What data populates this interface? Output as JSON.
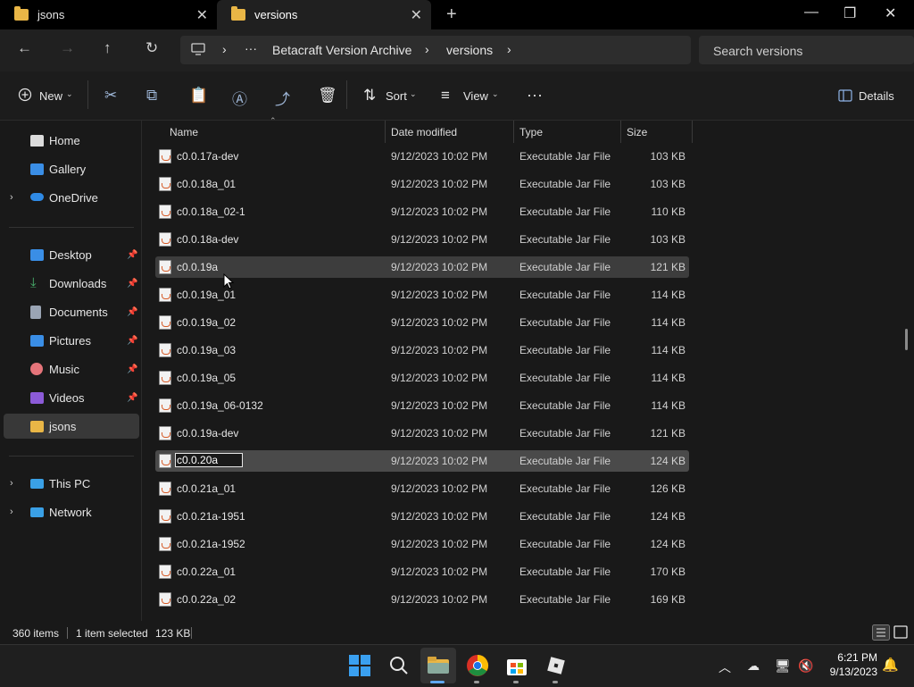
{
  "tabs": [
    {
      "label": "jsons"
    },
    {
      "label": "versions"
    }
  ],
  "window_controls": {
    "minimize": "—",
    "maximize": "❐",
    "close": "✕",
    "new_tab": "+",
    "tab_close": "✕"
  },
  "nav": {
    "back": "←",
    "forward": "→",
    "up": "↑",
    "refresh": "↻"
  },
  "address": {
    "ellipsis": "···",
    "crumbs": [
      "Betacraft Version Archive",
      "versions"
    ],
    "chevron": "›"
  },
  "search": {
    "placeholder": "Search versions"
  },
  "toolbar": {
    "new_label": "New",
    "sort_label": "Sort",
    "view_label": "View",
    "more": "···",
    "details_label": "Details"
  },
  "sidebar": {
    "items": [
      {
        "label": "Home",
        "color": "#ffffff"
      },
      {
        "label": "Gallery",
        "color": "#3a8ee6"
      },
      {
        "label": "OneDrive",
        "color": "#2f8ae5"
      },
      {
        "label": "Desktop",
        "color": "#3a8ee6"
      },
      {
        "label": "Downloads",
        "color": "#49b26d"
      },
      {
        "label": "Documents",
        "color": "#9aa4b4"
      },
      {
        "label": "Pictures",
        "color": "#3a8ee6"
      },
      {
        "label": "Music",
        "color": "#e5747a"
      },
      {
        "label": "Videos",
        "color": "#8c5bd8"
      },
      {
        "label": "jsons",
        "color": "#e9b646"
      },
      {
        "label": "This PC",
        "color": "#3aa0e6"
      },
      {
        "label": "Network",
        "color": "#3aa0e6"
      }
    ],
    "pin": "📌",
    "expand": "›"
  },
  "columns": {
    "name": "Name",
    "date": "Date modified",
    "type": "Type",
    "size": "Size"
  },
  "files": [
    {
      "name": "c0.0.17a-dev",
      "date": "9/12/2023 10:02 PM",
      "type": "Executable Jar File",
      "size": "103 KB"
    },
    {
      "name": "c0.0.18a_01",
      "date": "9/12/2023 10:02 PM",
      "type": "Executable Jar File",
      "size": "103 KB"
    },
    {
      "name": "c0.0.18a_02-1",
      "date": "9/12/2023 10:02 PM",
      "type": "Executable Jar File",
      "size": "110 KB"
    },
    {
      "name": "c0.0.18a-dev",
      "date": "9/12/2023 10:02 PM",
      "type": "Executable Jar File",
      "size": "103 KB"
    },
    {
      "name": "c0.0.19a",
      "date": "9/12/2023 10:02 PM",
      "type": "Executable Jar File",
      "size": "121 KB"
    },
    {
      "name": "c0.0.19a_01",
      "date": "9/12/2023 10:02 PM",
      "type": "Executable Jar File",
      "size": "114 KB"
    },
    {
      "name": "c0.0.19a_02",
      "date": "9/12/2023 10:02 PM",
      "type": "Executable Jar File",
      "size": "114 KB"
    },
    {
      "name": "c0.0.19a_03",
      "date": "9/12/2023 10:02 PM",
      "type": "Executable Jar File",
      "size": "114 KB"
    },
    {
      "name": "c0.0.19a_05",
      "date": "9/12/2023 10:02 PM",
      "type": "Executable Jar File",
      "size": "114 KB"
    },
    {
      "name": "c0.0.19a_06-0132",
      "date": "9/12/2023 10:02 PM",
      "type": "Executable Jar File",
      "size": "114 KB"
    },
    {
      "name": "c0.0.19a-dev",
      "date": "9/12/2023 10:02 PM",
      "type": "Executable Jar File",
      "size": "121 KB"
    },
    {
      "name": "c0.0.20a",
      "date": "9/12/2023 10:02 PM",
      "type": "Executable Jar File",
      "size": "124 KB"
    },
    {
      "name": "c0.0.21a_01",
      "date": "9/12/2023 10:02 PM",
      "type": "Executable Jar File",
      "size": "126 KB"
    },
    {
      "name": "c0.0.21a-1951",
      "date": "9/12/2023 10:02 PM",
      "type": "Executable Jar File",
      "size": "124 KB"
    },
    {
      "name": "c0.0.21a-1952",
      "date": "9/12/2023 10:02 PM",
      "type": "Executable Jar File",
      "size": "124 KB"
    },
    {
      "name": "c0.0.22a_01",
      "date": "9/12/2023 10:02 PM",
      "type": "Executable Jar File",
      "size": "170 KB"
    },
    {
      "name": "c0.0.22a_02",
      "date": "9/12/2023 10:02 PM",
      "type": "Executable Jar File",
      "size": "169 KB"
    }
  ],
  "status": {
    "count": "360 items",
    "selected": "1 item selected",
    "selected_size": "123 KB"
  },
  "clock": {
    "time": "6:21 PM",
    "date": "9/13/2023"
  },
  "colors": {
    "folder": "#e9b646",
    "accent": "#0078d4",
    "selection": "#4a4a4a"
  }
}
